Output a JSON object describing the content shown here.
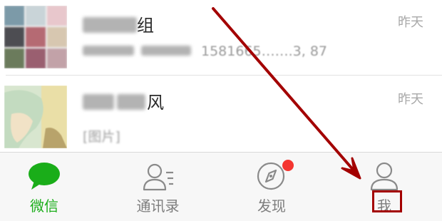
{
  "chats": [
    {
      "name_suffix": "组",
      "time": "昨天",
      "preview": "1581665…….3, 87"
    },
    {
      "name_suffix": "风",
      "time": "昨天",
      "tag": "[图片]"
    }
  ],
  "tabs": [
    {
      "label": "微信",
      "icon": "chat-bubble-icon",
      "active": true
    },
    {
      "label": "通讯录",
      "icon": "contacts-icon",
      "active": false
    },
    {
      "label": "发现",
      "icon": "compass-icon",
      "active": false,
      "badge": true
    },
    {
      "label": "我",
      "icon": "profile-icon",
      "active": false,
      "highlighted": true
    }
  ],
  "colors": {
    "active_green": "#1aad19",
    "badge_red": "#f43530",
    "annotation_red": "#a30000"
  }
}
